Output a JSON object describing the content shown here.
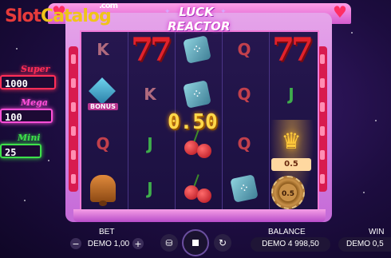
{
  "watermark": {
    "slot": "Slot",
    "catalog": "Catalog",
    "com": ".com"
  },
  "game": {
    "title_line1": "LUCK",
    "title_line2": "REACTOR"
  },
  "jackpots": [
    {
      "name": "Super",
      "value": "1000",
      "color": "#ff2e57"
    },
    {
      "name": "Mega",
      "value": "100",
      "color": "#ff4fd8"
    },
    {
      "name": "Mini",
      "value": "25",
      "color": "#3de04a"
    }
  ],
  "reels": [
    [
      "K",
      "diamond-bonus",
      "Q",
      "bell"
    ],
    [
      "seven",
      "K",
      "J",
      "J"
    ],
    [
      "dice",
      "dice",
      "cherry",
      "cherry"
    ],
    [
      "Q",
      "Q",
      "Q",
      "dice"
    ],
    [
      "seven",
      "J",
      "crown",
      "chip"
    ]
  ],
  "bonus_label": "BONUS",
  "win_overlay": "0.50",
  "crown_badge": "0.5",
  "chip_value": "0.5",
  "bottom": {
    "bet_label": "BET",
    "bet_value": "DEMO 1,00",
    "minus": "−",
    "plus": "+",
    "balance_label": "BALANCE",
    "balance_value": "DEMO 4 998,50",
    "win_label": "WIN",
    "win_value": "DEMO 0,5"
  },
  "icons": [
    "minus-icon",
    "plus-icon",
    "coin-stack-icon",
    "stop-icon",
    "autoplay-icon"
  ]
}
